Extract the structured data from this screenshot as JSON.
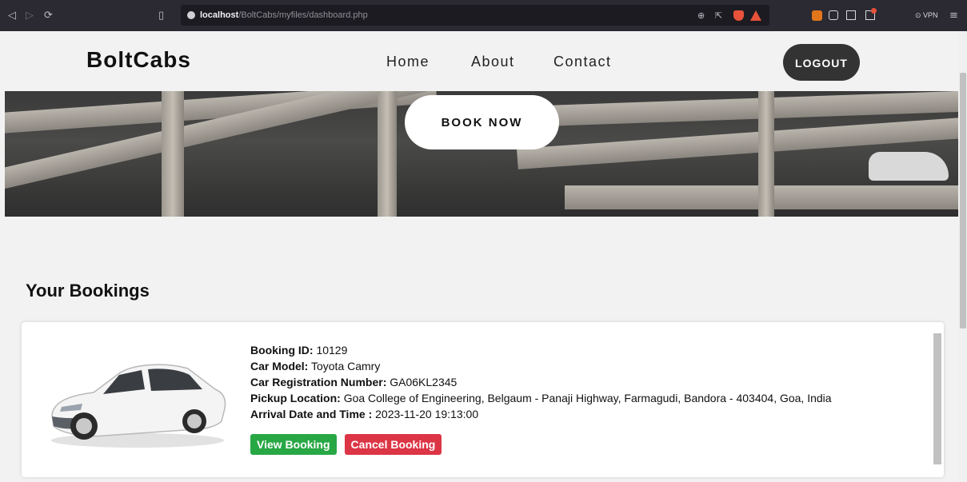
{
  "browser": {
    "url_host": "localhost",
    "url_path": "/BoltCabs/myfiles/dashboard.php",
    "vpn_label": "VPN",
    "icons": [
      "back-icon",
      "forward-icon",
      "reload-icon",
      "bookmark-icon",
      "lock-icon",
      "zoom-icon",
      "share-icon",
      "brave-shield-icon",
      "brave-rewards-icon",
      "metamask-icon",
      "wallet-icon",
      "sidebar-icon",
      "extensions-icon",
      "menu-icon"
    ]
  },
  "site": {
    "brand": "BoltCabs",
    "nav": [
      "Home",
      "About",
      "Contact"
    ],
    "logout_label": "LOGOUT",
    "book_now_label": "BOOK NOW"
  },
  "bookings": {
    "title": "Your Bookings",
    "items": [
      {
        "booking_id_label": "Booking ID:",
        "booking_id": "10129",
        "car_model_label": "Car Model:",
        "car_model": "Toyota Camry",
        "reg_label": "Car Registration Number:",
        "reg": "GA06KL2345",
        "pickup_label": "Pickup Location:",
        "pickup": "Goa College of Engineering, Belgaum - Panaji Highway, Farmagudi, Bandora - 403404, Goa, India",
        "arrival_label": "Arrival Date and Time :",
        "arrival": "2023-11-20 19:13:00",
        "view_label": "View Booking",
        "cancel_label": "Cancel Booking"
      }
    ]
  },
  "colors": {
    "page_bg": "#f2f2f2",
    "view_btn": "#28a745",
    "cancel_btn": "#dc3545",
    "logout_btn": "#333333",
    "chrome_bg": "#2b2a33"
  }
}
